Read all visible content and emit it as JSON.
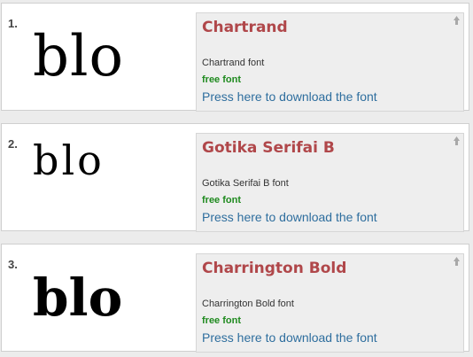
{
  "colors": {
    "title": "#b0474a",
    "free": "#1f8a1f",
    "link": "#2e6e9e",
    "panel": "#eeeeee"
  },
  "fonts": [
    {
      "number": "1.",
      "preview_text": "blo",
      "title": "Chartrand",
      "description": "Chartrand font",
      "license": "free font",
      "download_link": "Press here to download the font",
      "icon": "up-arrow-icon"
    },
    {
      "number": "2.",
      "preview_text": "blo",
      "title": "Gotika Serifai B",
      "description": "Gotika Serifai B font",
      "license": "free font",
      "download_link": "Press here to download the font",
      "icon": "up-arrow-icon"
    },
    {
      "number": "3.",
      "preview_text": "blo",
      "title": "Charrington Bold",
      "description": "Charrington Bold font",
      "license": "free font",
      "download_link": "Press here to download the font",
      "icon": "up-arrow-icon"
    }
  ]
}
